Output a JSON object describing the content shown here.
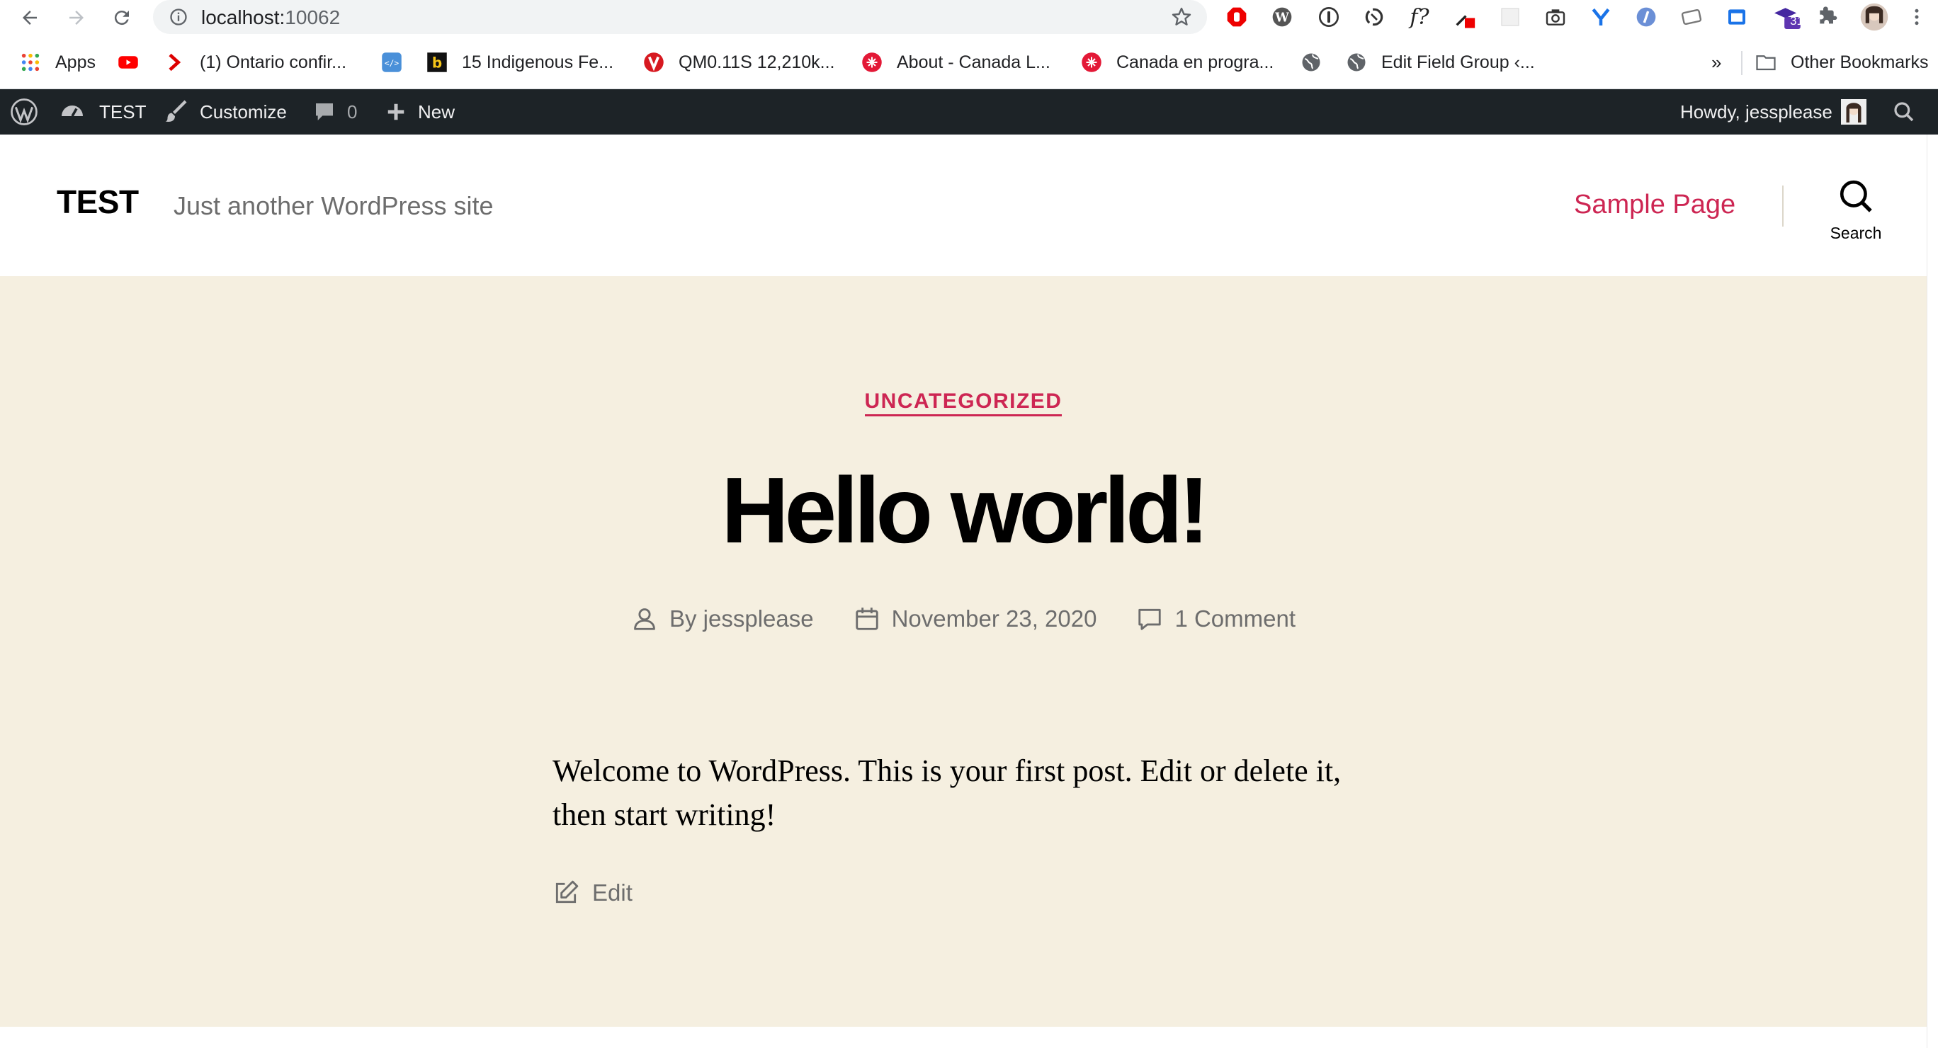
{
  "browser": {
    "url_host": "localhost:",
    "url_port": "10062",
    "ext_badge": "31"
  },
  "bookmarks": {
    "apps": "Apps",
    "items": [
      "(1) Ontario confir...",
      "15 Indigenous Fe...",
      "QM0.11S   12,210k...",
      "About - Canada L...",
      "Canada en progra...",
      "Edit Field Group ‹..."
    ],
    "overflow": "»",
    "other": "Other Bookmarks"
  },
  "adminbar": {
    "site": "TEST",
    "customize": "Customize",
    "comments_count": "0",
    "new": "New",
    "howdy": "Howdy, jessplease"
  },
  "header": {
    "site_title": "TEST",
    "tagline": "Just another WordPress site",
    "nav_item": "Sample Page",
    "search_label": "Search"
  },
  "post": {
    "category": "UNCATEGORIZED",
    "title": "Hello world!",
    "author": "By jessplease",
    "date": "November 23, 2020",
    "comments": "1 Comment",
    "body": "Welcome to WordPress. This is your first post. Edit or delete it, then start writing!",
    "edit": "Edit"
  },
  "colors": {
    "accent": "#cd2653",
    "adminbar_bg": "#1d2327",
    "content_bg": "#f5efe0"
  }
}
